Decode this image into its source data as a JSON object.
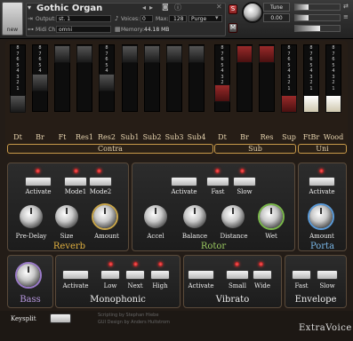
{
  "header": {
    "logo_label": "new",
    "instrument_title": "Gothic Organ",
    "output_label": "Output:",
    "output_value": "st. 1",
    "midi_label": "Midi Ch:",
    "midi_value": "omni",
    "voices_label": "Voices:",
    "voices_value": "0",
    "max_label": "Max:",
    "max_value": "128",
    "purge_label": "Purge",
    "memory_label": "Memory:",
    "memory_value": "44.18 MB",
    "s_label": "S",
    "m_label": "M",
    "tune_label": "Tune",
    "tune_value": "0.00",
    "colors": {
      "accent": "#c89a4a",
      "header_bg": "#2b2b2b",
      "red": "#c03030"
    }
  },
  "drawbars": {
    "scale": [
      "8",
      "7",
      "6",
      "5",
      "4",
      "3",
      "2",
      "1"
    ],
    "bars": [
      {
        "label": "Dt",
        "color": "black",
        "level": 8
      },
      {
        "label": "Br",
        "color": "black",
        "level": 4
      },
      {
        "label": "Ft",
        "color": "black",
        "level": 0
      },
      {
        "label": "Res1",
        "color": "black",
        "level": 0
      },
      {
        "label": "Res2",
        "color": "black",
        "level": 4
      },
      {
        "label": "Sub1",
        "color": "black",
        "level": 0
      },
      {
        "label": "Sub2",
        "color": "black",
        "level": 0
      },
      {
        "label": "Sub3",
        "color": "black",
        "level": 0
      },
      {
        "label": "Sub4",
        "color": "black",
        "level": 0
      },
      {
        "label": "Dt",
        "color": "red",
        "level": 6
      },
      {
        "label": "Br",
        "color": "red",
        "level": 0
      },
      {
        "label": "Res",
        "color": "red",
        "level": 0
      },
      {
        "label": "Sup",
        "color": "red",
        "level": 8
      },
      {
        "label": "FtBr",
        "color": "white",
        "level": 8
      },
      {
        "label": "Wood",
        "color": "white",
        "level": 8
      }
    ],
    "groups": {
      "contra": "Contra",
      "sub": "Sub",
      "uni": "Uni"
    }
  },
  "reverb": {
    "title": "Reverb",
    "activate": "Activate",
    "mode1": "Mode1",
    "mode2": "Mode2",
    "predelay": "Pre-Delay",
    "size": "Size",
    "amount": "Amount"
  },
  "rotor": {
    "title": "Rotor",
    "activate": "Activate",
    "fast": "Fast",
    "slow": "Slow",
    "accel": "Accel",
    "balance": "Balance",
    "distance": "Distance",
    "wet": "Wet"
  },
  "porta": {
    "title": "Porta",
    "activate": "Activate",
    "amount": "Amount"
  },
  "bass": {
    "title": "Bass"
  },
  "monophonic": {
    "title": "Monophonic",
    "activate": "Activate",
    "low": "Low",
    "next": "Next",
    "high": "High"
  },
  "vibrato": {
    "title": "Vibrato",
    "activate": "Activate",
    "small": "Small",
    "wide": "Wide"
  },
  "envelope": {
    "title": "Envelope",
    "fast": "Fast",
    "slow": "Slow"
  },
  "keysplit": {
    "label": "Keysplit"
  },
  "credits": {
    "line1": "Scripting by Stephan Hiebe",
    "line2": "GUI Design by Anders Hultstrom",
    "brand": "ExtraVoice"
  }
}
